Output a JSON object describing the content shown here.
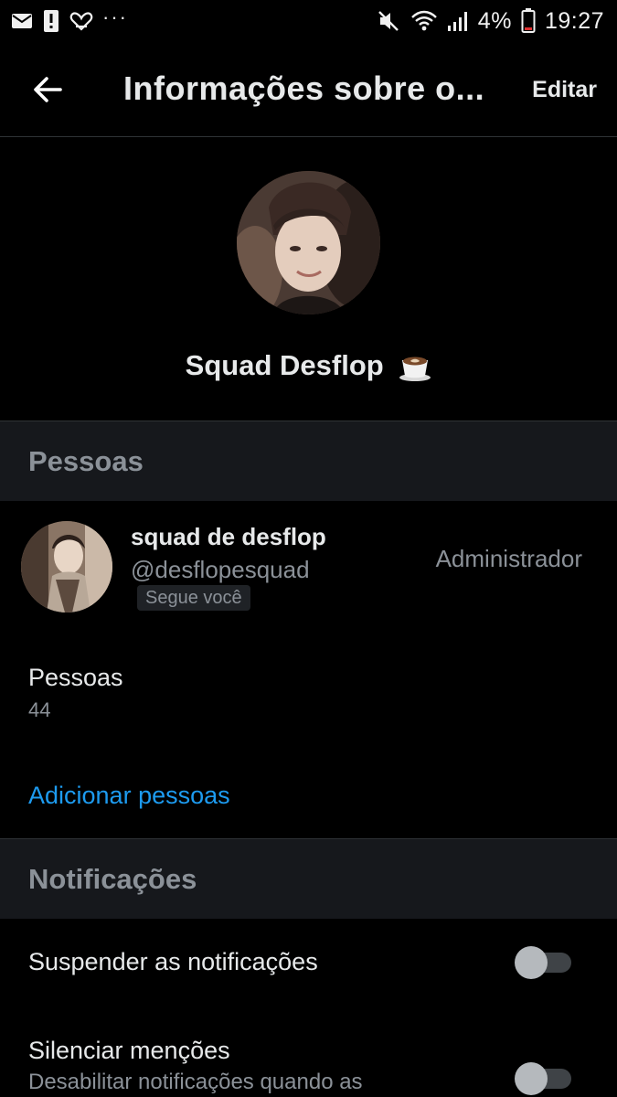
{
  "status_bar": {
    "battery": "4%",
    "time": "19:27",
    "notification_icons": [
      "mail-icon",
      "alert-icon",
      "heart-icon"
    ],
    "more": "···"
  },
  "header": {
    "title": "Informações sobre o...",
    "edit_label": "Editar"
  },
  "group": {
    "name": "Squad Desflop",
    "emoji_icon": "coffee-cup-icon"
  },
  "people_section": {
    "title": "Pessoas",
    "member": {
      "name": "squad de desflop",
      "handle": "@desflopesquad",
      "badge": "Segue você",
      "role": "Administrador"
    },
    "people_label": "Pessoas",
    "people_count": "44",
    "add_label": "Adicionar pessoas"
  },
  "notifications_section": {
    "title": "Notificações",
    "items": [
      {
        "label": "Suspender as notificações",
        "description": "",
        "enabled": false
      },
      {
        "label": "Silenciar menções",
        "description": "Desabilitar notificações quando as",
        "enabled": false
      }
    ]
  },
  "colors": {
    "background": "#000000",
    "section_bg": "#16181c",
    "primary_text": "#e7e9ea",
    "secondary_text": "#8b9198",
    "link": "#1d9bf0"
  }
}
